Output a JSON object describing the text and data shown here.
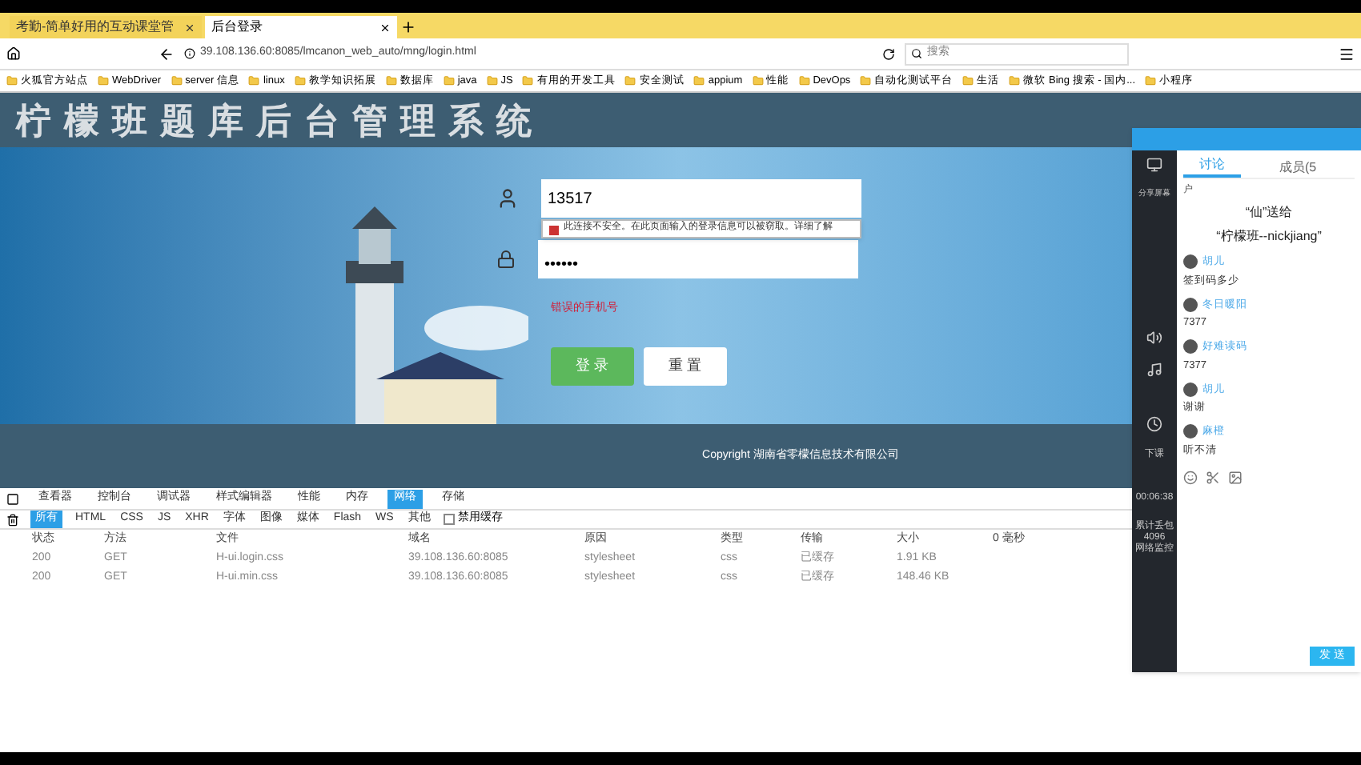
{
  "browser": {
    "tabs": [
      {
        "label": "考勤-简单好用的互动课堂管",
        "selected": false
      },
      {
        "label": "后台登录",
        "selected": true
      }
    ],
    "url": "39.108.136.60:8085/lmcanon_web_auto/mng/login.html",
    "search": {
      "placeholder": "搜索"
    },
    "bookmarks": [
      "火狐官方站点",
      "WebDriver",
      "server 信息",
      "linux",
      "教学知识拓展",
      "数据库",
      "java",
      "JS",
      "有用的开发工具",
      "安全测试",
      "appium",
      "性能",
      "DevOps",
      "自动化测试平台",
      "生活",
      "微软 Bing 搜索 - 国内...",
      "小程序"
    ]
  },
  "page": {
    "title": "柠檬班题库后台管理系统",
    "username": {
      "value": "13517"
    },
    "password": {
      "value": "••••••"
    },
    "warning": "此连接不安全。在此页面输入的登录信息可以被窃取。详细了解",
    "error": "错误的手机号",
    "buttons": [
      "登 录",
      "重 置"
    ],
    "footer": "Copyright 湖南省零檬信息技术有限公司"
  },
  "devtools": {
    "tabs": [
      {
        "label": "查看器",
        "selected": false
      },
      {
        "label": "控制台",
        "selected": false
      },
      {
        "label": "调试器",
        "selected": false
      },
      {
        "label": "样式编辑器",
        "selected": false
      },
      {
        "label": "性能",
        "selected": false
      },
      {
        "label": "内存",
        "selected": false
      },
      {
        "label": "网络",
        "selected": true
      },
      {
        "label": "存储",
        "selected": false
      }
    ],
    "filters": [
      {
        "label": "所有",
        "selected": true
      },
      {
        "label": "HTML",
        "selected": false
      },
      {
        "label": "CSS",
        "selected": false
      },
      {
        "label": "JS",
        "selected": false
      },
      {
        "label": "XHR",
        "selected": false
      },
      {
        "label": "字体",
        "selected": false
      },
      {
        "label": "图像",
        "selected": false
      },
      {
        "label": "媒体",
        "selected": false
      },
      {
        "label": "Flash",
        "selected": false
      },
      {
        "label": "WS",
        "selected": false
      },
      {
        "label": "其他",
        "selected": false
      }
    ],
    "disable_cache": {
      "label": "禁用缓存",
      "checked": false
    },
    "table": {
      "columns": [
        "状态",
        "方法",
        "文件",
        "域名",
        "原因",
        "类型",
        "传输",
        "大小",
        "0 毫秒"
      ],
      "rows": [
        [
          "200",
          "GET",
          "H-ui.login.css",
          "39.108.136.60:8085",
          "stylesheet",
          "css",
          "已缓存",
          "1.91 KB"
        ],
        [
          "200",
          "GET",
          "H-ui.min.css",
          "39.108.136.60:8085",
          "stylesheet",
          "css",
          "已缓存",
          "148.46 KB"
        ]
      ]
    }
  },
  "chat": {
    "side_items": [
      "分享屏幕",
      "下课"
    ],
    "timer": "00:06:38",
    "stats": [
      "累计丢包",
      "4096",
      "网络监控"
    ],
    "tabs": [
      {
        "label": "讨论",
        "selected": true
      },
      {
        "label": "成员(5",
        "selected": false
      }
    ],
    "partial": "户",
    "gift": [
      "“仙”送给",
      "“柠檬班--nickjiang”"
    ],
    "messages": [
      {
        "user": "胡儿",
        "text": "签到码多少"
      },
      {
        "user": "冬日暖阳",
        "text": "7377"
      },
      {
        "user": "好难读码",
        "text": "7377"
      },
      {
        "user": "胡儿",
        "text": "谢谢"
      },
      {
        "user": "麻橙",
        "text": "听不清"
      }
    ],
    "send": "发 送"
  }
}
